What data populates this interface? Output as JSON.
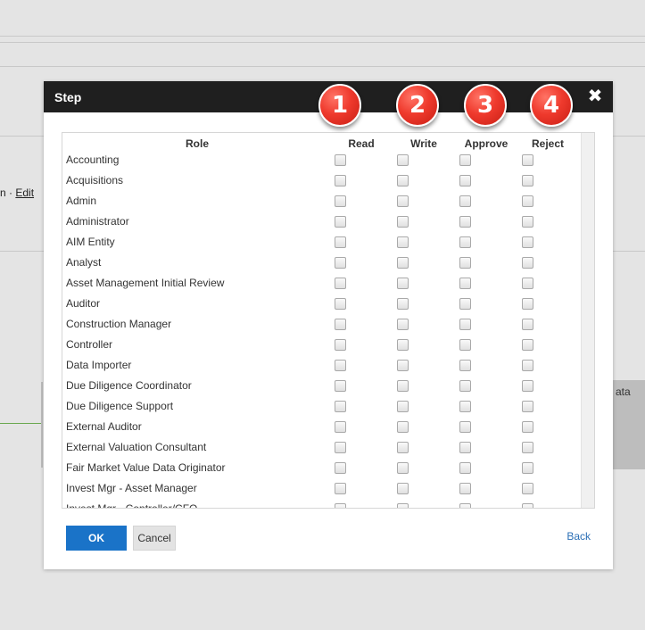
{
  "background": {
    "edit_prefix": "n ·",
    "edit_link": "Edit",
    "partial_text": "ata"
  },
  "dialog": {
    "title": "Step",
    "close_glyph": "✖",
    "callouts": [
      "1",
      "2",
      "3",
      "4"
    ],
    "columns": {
      "role": "Role",
      "read": "Read",
      "write": "Write",
      "approve": "Approve",
      "reject": "Reject"
    },
    "roles": [
      {
        "name": "Accounting",
        "read": false,
        "write": false,
        "approve": false,
        "reject": false
      },
      {
        "name": "Acquisitions",
        "read": false,
        "write": false,
        "approve": false,
        "reject": false
      },
      {
        "name": "Admin",
        "read": false,
        "write": false,
        "approve": false,
        "reject": false
      },
      {
        "name": "Administrator",
        "read": false,
        "write": false,
        "approve": false,
        "reject": false
      },
      {
        "name": "AIM Entity",
        "read": false,
        "write": false,
        "approve": false,
        "reject": false
      },
      {
        "name": "Analyst",
        "read": false,
        "write": false,
        "approve": false,
        "reject": false
      },
      {
        "name": "Asset Management Initial Review",
        "read": false,
        "write": false,
        "approve": false,
        "reject": false
      },
      {
        "name": "Auditor",
        "read": false,
        "write": false,
        "approve": false,
        "reject": false
      },
      {
        "name": "Construction Manager",
        "read": false,
        "write": false,
        "approve": false,
        "reject": false
      },
      {
        "name": "Controller",
        "read": false,
        "write": false,
        "approve": false,
        "reject": false
      },
      {
        "name": "Data Importer",
        "read": false,
        "write": false,
        "approve": false,
        "reject": false
      },
      {
        "name": "Due Diligence Coordinator",
        "read": false,
        "write": false,
        "approve": false,
        "reject": false
      },
      {
        "name": "Due Diligence Support",
        "read": false,
        "write": false,
        "approve": false,
        "reject": false
      },
      {
        "name": "External Auditor",
        "read": false,
        "write": false,
        "approve": false,
        "reject": false
      },
      {
        "name": "External Valuation Consultant",
        "read": false,
        "write": false,
        "approve": false,
        "reject": false
      },
      {
        "name": "Fair Market Value Data Originator",
        "read": false,
        "write": false,
        "approve": false,
        "reject": false
      },
      {
        "name": "Invest Mgr - Asset Manager",
        "read": false,
        "write": false,
        "approve": false,
        "reject": false
      },
      {
        "name": "Invest Mgr - Controller/CFO",
        "read": false,
        "write": false,
        "approve": false,
        "reject": false
      }
    ],
    "ok_label": "OK",
    "cancel_label": "Cancel",
    "back_label": "Back"
  }
}
